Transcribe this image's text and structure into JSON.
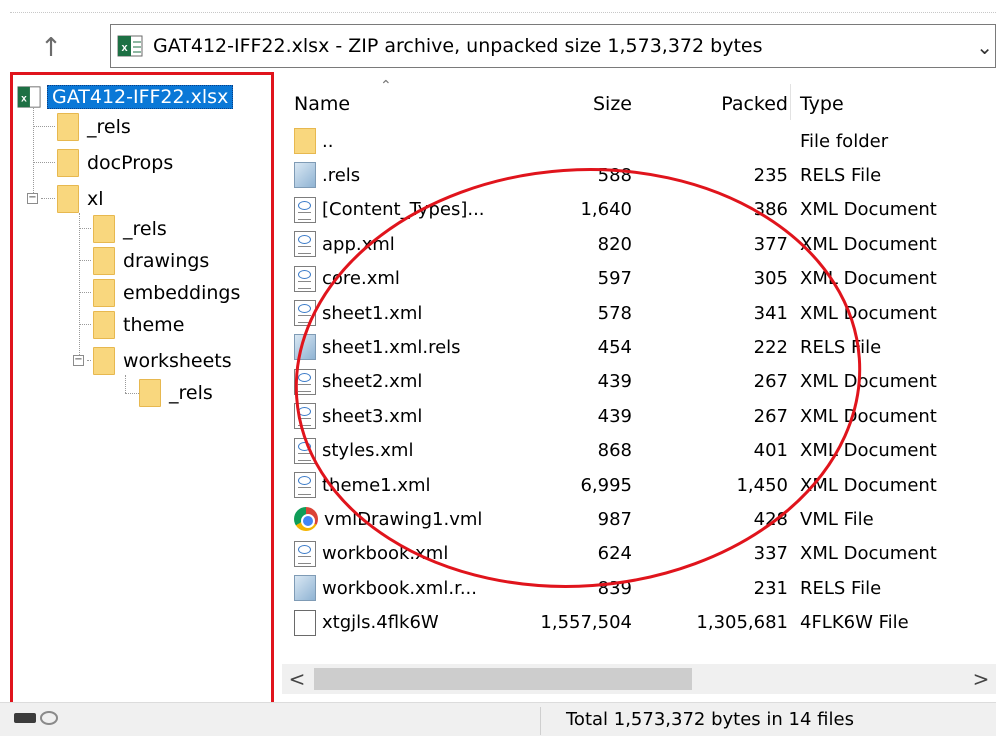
{
  "address_bar": {
    "text": "GAT412-IFF22.xlsx - ZIP archive, unpacked size 1,573,372 bytes",
    "up_icon": "up-arrow-icon",
    "dropdown_icon": "chevron-down-icon"
  },
  "tree": {
    "root": "GAT412-IFF22.xlsx",
    "items": [
      {
        "label": "_rels"
      },
      {
        "label": "docProps"
      },
      {
        "label": "xl"
      },
      {
        "label": "_rels"
      },
      {
        "label": "drawings"
      },
      {
        "label": "embeddings"
      },
      {
        "label": "theme"
      },
      {
        "label": "worksheets"
      },
      {
        "label": "_rels"
      }
    ],
    "expanders": [
      "−",
      "−"
    ]
  },
  "list": {
    "columns": {
      "name": "Name",
      "size": "Size",
      "packed": "Packed",
      "type": "Type"
    },
    "rows": [
      {
        "name": "..",
        "size": "",
        "packed": "",
        "type": "File folder",
        "icon": "folder-icon"
      },
      {
        "name": ".rels",
        "size": "588",
        "packed": "235",
        "type": "RELS File",
        "icon": "rels-file-icon"
      },
      {
        "name": "[Content_Types]...",
        "size": "1,640",
        "packed": "386",
        "type": "XML Document",
        "icon": "xml-file-icon"
      },
      {
        "name": "app.xml",
        "size": "820",
        "packed": "377",
        "type": "XML Document",
        "icon": "xml-file-icon"
      },
      {
        "name": "core.xml",
        "size": "597",
        "packed": "305",
        "type": "XML Document",
        "icon": "xml-file-icon"
      },
      {
        "name": "sheet1.xml",
        "size": "578",
        "packed": "341",
        "type": "XML Document",
        "icon": "xml-file-icon"
      },
      {
        "name": "sheet1.xml.rels",
        "size": "454",
        "packed": "222",
        "type": "RELS File",
        "icon": "rels-file-icon"
      },
      {
        "name": "sheet2.xml",
        "size": "439",
        "packed": "267",
        "type": "XML Document",
        "icon": "xml-file-icon"
      },
      {
        "name": "sheet3.xml",
        "size": "439",
        "packed": "267",
        "type": "XML Document",
        "icon": "xml-file-icon"
      },
      {
        "name": "styles.xml",
        "size": "868",
        "packed": "401",
        "type": "XML Document",
        "icon": "xml-file-icon"
      },
      {
        "name": "theme1.xml",
        "size": "6,995",
        "packed": "1,450",
        "type": "XML Document",
        "icon": "xml-file-icon"
      },
      {
        "name": "vmlDrawing1.vml",
        "size": "987",
        "packed": "428",
        "type": "VML File",
        "icon": "chrome-icon"
      },
      {
        "name": "workbook.xml",
        "size": "624",
        "packed": "337",
        "type": "XML Document",
        "icon": "xml-file-icon"
      },
      {
        "name": "workbook.xml.r...",
        "size": "839",
        "packed": "231",
        "type": "RELS File",
        "icon": "rels-file-icon"
      },
      {
        "name": "xtgjls.4flk6W",
        "size": "1,557,504",
        "packed": "1,305,681",
        "type": "4FLK6W File",
        "icon": "blank-file-icon"
      }
    ]
  },
  "scrollbar": {
    "left_arrow": "<",
    "right_arrow": ">"
  },
  "status": {
    "text": "Total 1,573,372 bytes in 14 files"
  },
  "colors": {
    "annotation": "#e0141c",
    "selection": "#0a78d7",
    "folder": "#f9d77e"
  }
}
